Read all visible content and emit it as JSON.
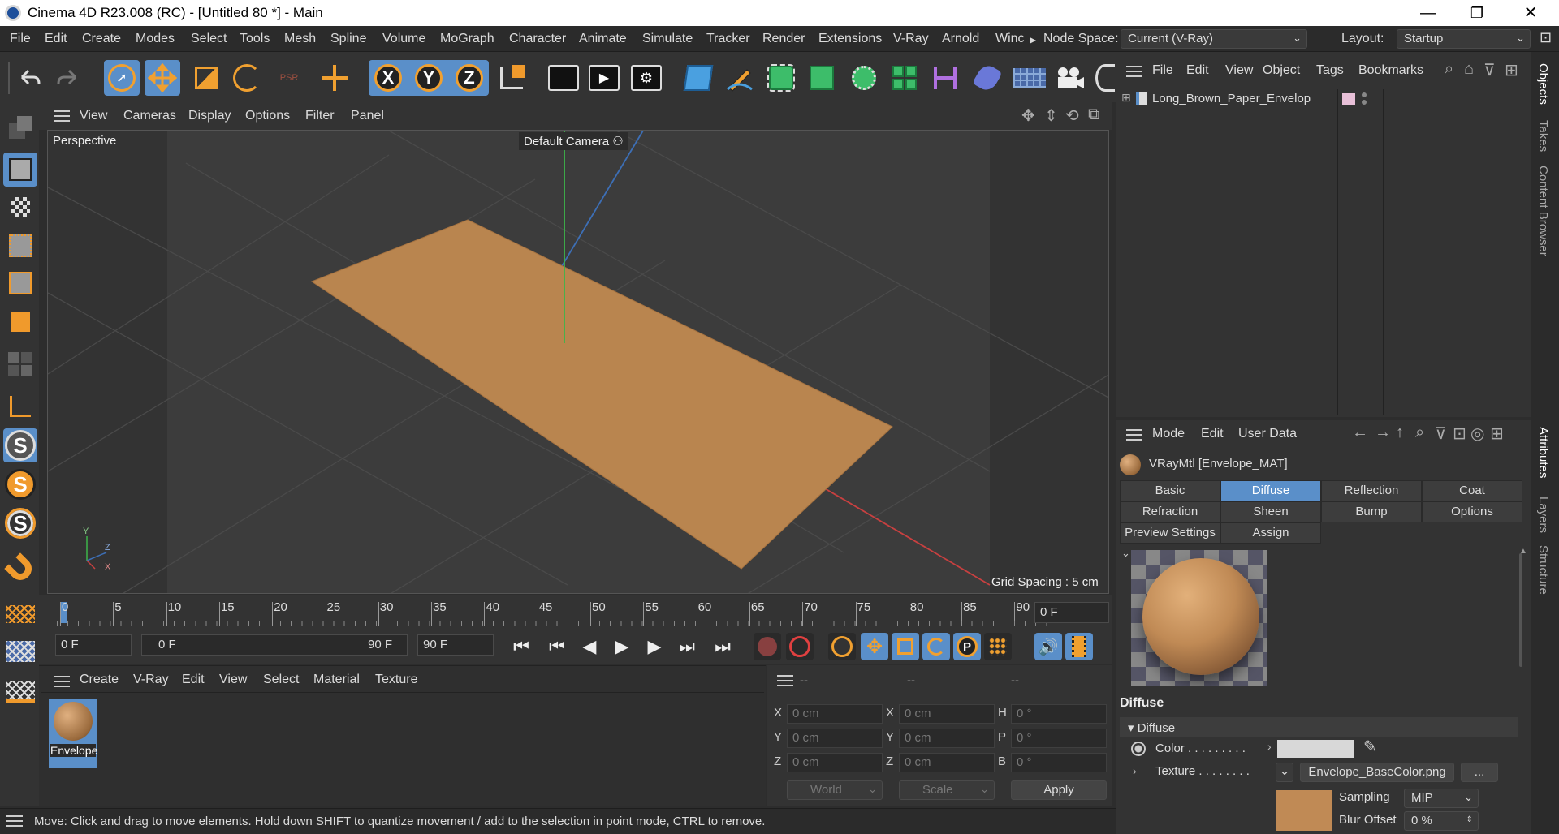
{
  "window": {
    "title": "Cinema 4D R23.008 (RC) - [Untitled 80 *] - Main",
    "minimize": "—",
    "maximize": "❐",
    "close": "✕"
  },
  "menubar": {
    "items": [
      "File",
      "Edit",
      "Create",
      "Modes",
      "Select",
      "Tools",
      "Mesh",
      "Spline",
      "Volume",
      "MoGraph",
      "Character",
      "Animate",
      "Simulate",
      "Tracker",
      "Render",
      "Extensions",
      "V-Ray",
      "Arnold",
      "Winc"
    ],
    "overflow": "▸",
    "node_space_label": "Node Space:",
    "node_space_value": "Current (V-Ray)",
    "layout_label": "Layout:",
    "layout_value": "Startup"
  },
  "toolbar": {
    "axis_x": "X",
    "axis_y": "Y",
    "axis_z": "Z",
    "psr": "PSR",
    "icons": [
      "undo-icon",
      "redo-icon",
      "select-arrow-icon",
      "move-icon",
      "scale-icon",
      "rotate-icon",
      "psr-icon",
      "coord-move-icon",
      "axis-x-icon",
      "axis-y-icon",
      "axis-z-icon",
      "coordinate-system-icon",
      "render-view-icon",
      "render-icon",
      "render-settings-icon",
      "cube-icon",
      "pen-icon",
      "subdivision-icon",
      "extrude-icon",
      "cloner-icon",
      "array-icon",
      "symmetry-icon",
      "deformer-icon",
      "floor-icon",
      "camera-icon"
    ]
  },
  "viewport": {
    "menu": [
      "View",
      "Cameras",
      "Display",
      "Options",
      "Filter",
      "Panel"
    ],
    "view_name": "Perspective",
    "camera": "Default Camera",
    "camera_icon": "⚇",
    "grid_spacing": "Grid Spacing : 5 cm",
    "axis_labels": {
      "x": "X",
      "y": "Y",
      "z": "Z"
    },
    "plane_color": "#c08a55"
  },
  "timeline": {
    "ticks": [
      "0",
      "5",
      "10",
      "15",
      "20",
      "25",
      "30",
      "35",
      "40",
      "45",
      "50",
      "55",
      "60",
      "65",
      "70",
      "75",
      "80",
      "85",
      "90"
    ],
    "current_frame": "0 F"
  },
  "transport": {
    "start": "0 F",
    "range_start": "0 F",
    "range_end": "90 F",
    "end": "90 F",
    "key_p": "P"
  },
  "material_manager": {
    "menu": [
      "Create",
      "V-Ray",
      "Edit",
      "View",
      "Select",
      "Material",
      "Texture"
    ],
    "materials": [
      {
        "name": "Envelope",
        "color": "#c08a55"
      }
    ]
  },
  "coordinates": {
    "headers": [
      "--",
      "--",
      "--"
    ],
    "rows": [
      {
        "l1": "X",
        "v1": "0 cm",
        "l2": "X",
        "v2": "0 cm",
        "l3": "H",
        "v3": "0 °"
      },
      {
        "l1": "Y",
        "v1": "0 cm",
        "l2": "Y",
        "v2": "0 cm",
        "l3": "P",
        "v3": "0 °"
      },
      {
        "l1": "Z",
        "v1": "0 cm",
        "l2": "Z",
        "v2": "0 cm",
        "l3": "B",
        "v3": "0 °"
      }
    ],
    "mode": "World",
    "size_mode": "Scale",
    "apply": "Apply"
  },
  "status": "Move: Click and drag to move elements. Hold down SHIFT to quantize movement / add to the selection in point mode, CTRL to remove.",
  "object_manager": {
    "menu": [
      "File",
      "Edit",
      "View",
      "Object",
      "Tags",
      "Bookmarks"
    ],
    "objects": [
      {
        "name": "Long_Brown_Paper_Envelope_g",
        "expand": "⊞"
      }
    ]
  },
  "attributes": {
    "menu": [
      "Mode",
      "Edit",
      "User Data"
    ],
    "material_title": "VRayMtl [Envelope_MAT]",
    "tabs_row1": [
      "Basic",
      "Diffuse",
      "Reflection",
      "Coat"
    ],
    "tabs_row2": [
      "Refraction",
      "Sheen",
      "Bump",
      "Options"
    ],
    "tabs_row3": [
      "Preview Settings",
      "Assign"
    ],
    "active_tab": "Diffuse",
    "section": "Diffuse",
    "group": "Diffuse",
    "color_label": "Color . . . . . . . . .",
    "color_value": "#d8d8d8",
    "texture_label": "Texture . . . . . . . .",
    "texture_file": "Envelope_BaseColor.png",
    "texture_more": "...",
    "sampling_label": "Sampling",
    "sampling_value": "MIP",
    "blur_label": "Blur Offset",
    "blur_value": "0 %"
  },
  "side_tabs": [
    "Objects",
    "Takes",
    "Content Browser",
    "Attributes",
    "Layers",
    "Structure"
  ]
}
